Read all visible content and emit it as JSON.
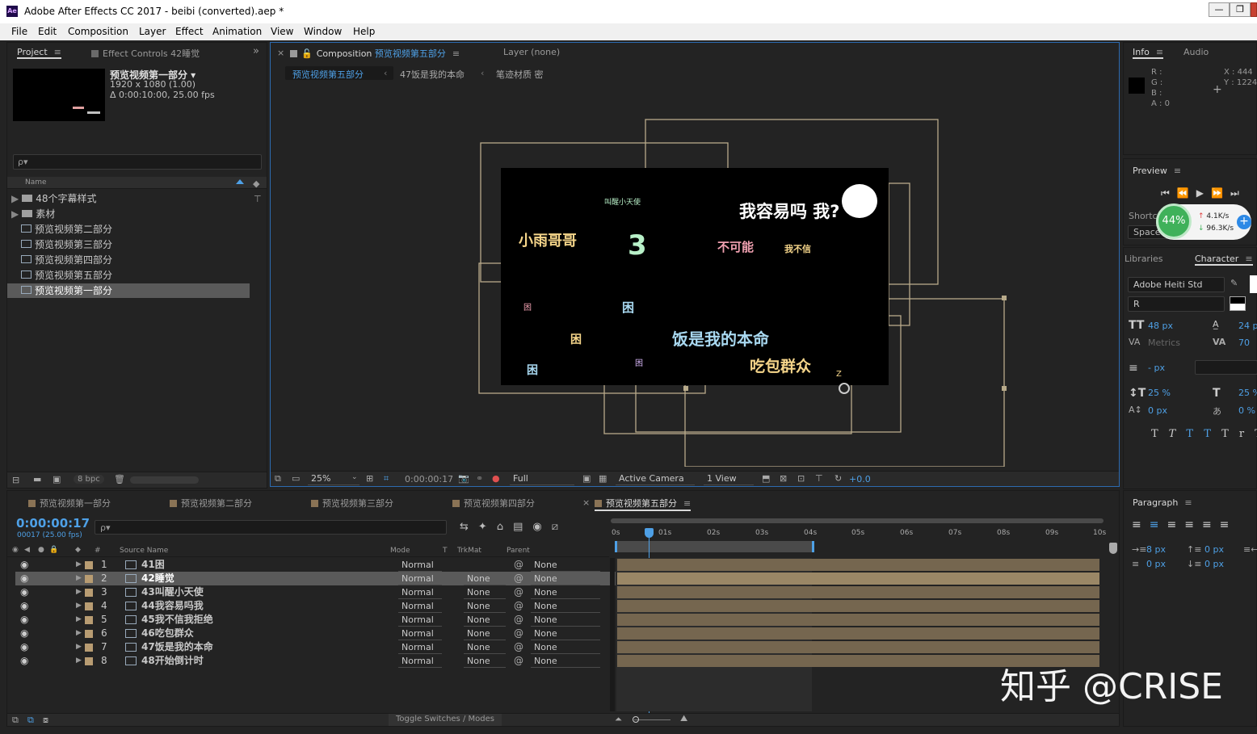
{
  "window": {
    "title": "Adobe After Effects CC 2017 - beibi (converted).aep *",
    "app_icon": "Ae",
    "min": "—",
    "max": "❐",
    "close": "✕"
  },
  "menu": [
    "File",
    "Edit",
    "Composition",
    "Layer",
    "Effect",
    "Animation",
    "View",
    "Window",
    "Help"
  ],
  "project": {
    "tab": "Project",
    "effect_controls": "Effect Controls 42睡觉",
    "comp_name": "预览视频第一部分 ▾",
    "res": "1920 x 1080 (1.00)",
    "dur": "Δ 0:00:10:00, 25.00 fps",
    "search_placeholder": "ρ▾",
    "col_name": "Name",
    "items": [
      "48个字幕样式",
      "素材",
      "预览视频第二部分",
      "预览视频第三部分",
      "预览视频第四部分",
      "预览视频第五部分",
      "预览视频第一部分"
    ],
    "bpc": "8 bpc"
  },
  "comp": {
    "tab_prefix": "Composition",
    "tab_name": "预览视频第五部分",
    "layer_tab": "Layer (none)",
    "crumbs": [
      "预览视频第五部分",
      "47饭是我的本命",
      "笔迹材质 密"
    ],
    "zoom": "25%",
    "time": "0:00:00:17",
    "res": "Full",
    "camera": "Active Camera",
    "views": "1 View",
    "exposure": "+0.0"
  },
  "canvas": {
    "t1": "小雨哥哥",
    "t2": "3",
    "t3": "我容易吗 我?",
    "t4": "不可能",
    "t5": "我不信",
    "t6": "叫醒小天使",
    "t7": "困",
    "t8": "困",
    "t9": "困",
    "t10": "饭是我的本命",
    "t11": "吃包群众",
    "t12": "困",
    "t13": "困",
    "t14": "Z"
  },
  "info": {
    "tab": "Info",
    "audio": "Audio",
    "r": "R :",
    "g": "G :",
    "b": "B :",
    "a": "A : 0",
    "x": "X : 444",
    "y": "Y : 1224"
  },
  "preview": {
    "tab": "Preview",
    "shortcut": "Shortc",
    "space": "Space",
    "pct": "44%",
    "up": "4.1K/s",
    "down": "96.3K/s"
  },
  "character": {
    "libraries": "Libraries",
    "tab": "Character",
    "font": "Adobe Heiti Std",
    "style": "R",
    "size": "48 px",
    "leading": "24 px",
    "kern": "Metrics",
    "track": "70",
    "stroke": "- px",
    "vscale": "25 %",
    "hscale": "25 %",
    "baseline": "0 px",
    "tsume": "0 %"
  },
  "paragraph": {
    "tab": "Paragraph",
    "indent_left": "8 px",
    "indent_right": "0 px",
    "indent_first": "0 px",
    "space_before": "0 px",
    "space_after": "0 px"
  },
  "timeline": {
    "tabs": [
      "预览视频第一部分",
      "预览视频第二部分",
      "预览视频第三部分",
      "预览视频第四部分",
      "预览视频第五部分"
    ],
    "time": "0:00:00:17",
    "frames": "00017 (25.00 fps)",
    "search_placeholder": "ρ▾",
    "cols": {
      "num": "#",
      "src": "Source Name",
      "mode": "Mode",
      "t": "T",
      "trkmat": "TrkMat",
      "parent": "Parent"
    },
    "toggle": "Toggle Switches / Modes",
    "ruler": [
      "0s",
      "01s",
      "02s",
      "03s",
      "04s",
      "05s",
      "06s",
      "07s",
      "08s",
      "09s",
      "10s"
    ],
    "layers": [
      {
        "n": "1",
        "name": "41困",
        "mode": "Normal",
        "trk": "",
        "parent": "None"
      },
      {
        "n": "2",
        "name": "42睡觉",
        "mode": "Normal",
        "trk": "None",
        "parent": "None"
      },
      {
        "n": "3",
        "name": "43叫醒小天使",
        "mode": "Normal",
        "trk": "None",
        "parent": "None"
      },
      {
        "n": "4",
        "name": "44我容易吗我",
        "mode": "Normal",
        "trk": "None",
        "parent": "None"
      },
      {
        "n": "5",
        "name": "45我不信我拒绝",
        "mode": "Normal",
        "trk": "None",
        "parent": "None"
      },
      {
        "n": "6",
        "name": "46吃包群众",
        "mode": "Normal",
        "trk": "None",
        "parent": "None"
      },
      {
        "n": "7",
        "name": "47饭是我的本命",
        "mode": "Normal",
        "trk": "None",
        "parent": "None"
      },
      {
        "n": "8",
        "name": "48开始倒计时",
        "mode": "Normal",
        "trk": "None",
        "parent": "None"
      }
    ]
  },
  "watermark": "知乎 @CRISE"
}
